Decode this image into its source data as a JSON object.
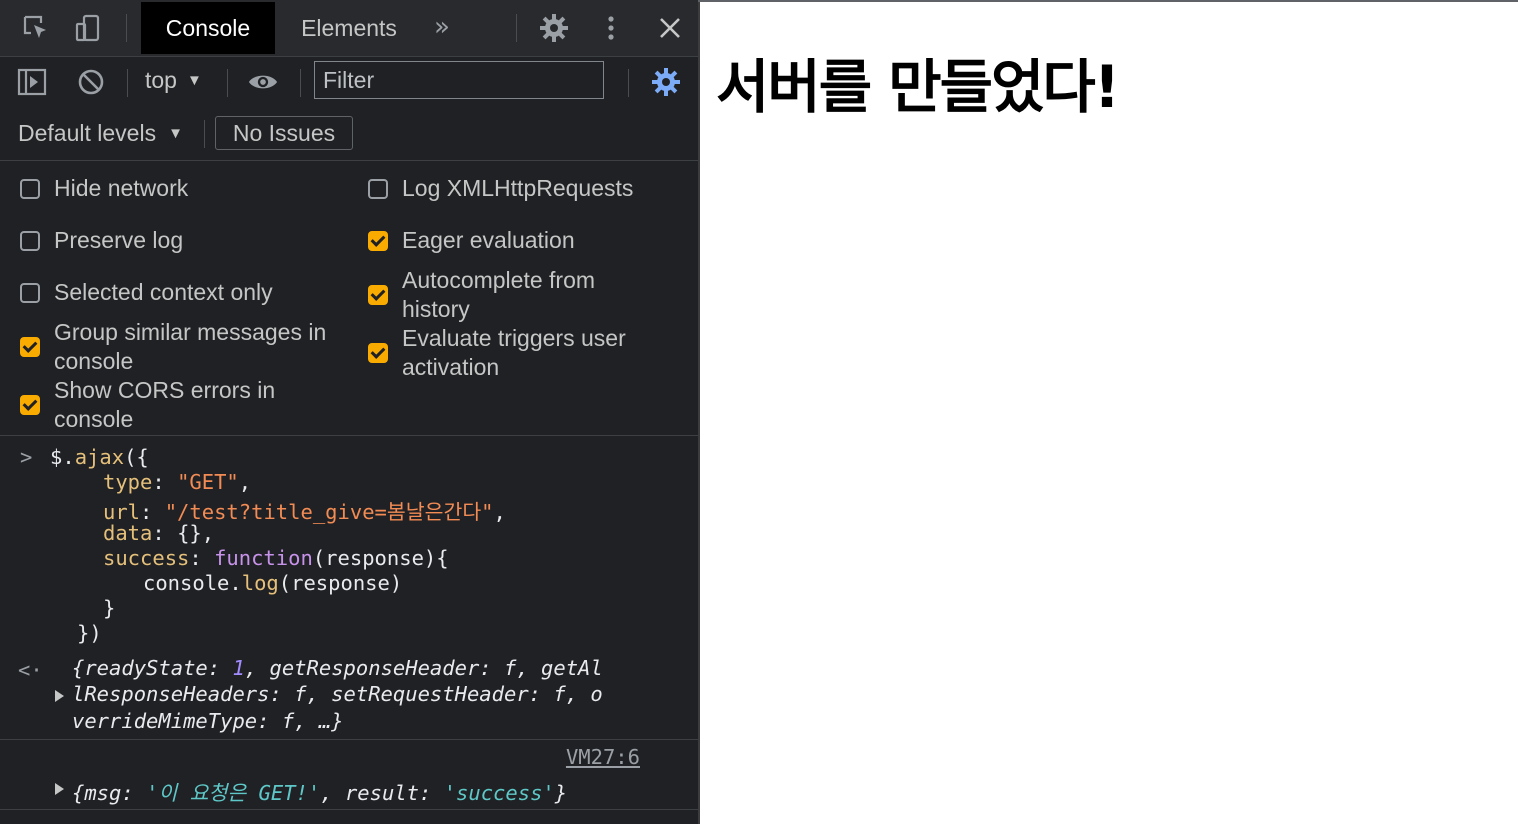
{
  "devtools": {
    "tabs": [
      {
        "label": "Console",
        "active": true
      },
      {
        "label": "Elements",
        "active": false
      }
    ],
    "more_tabs": "»",
    "toolbar": {
      "context": "top",
      "filter_placeholder": "Filter",
      "default_levels": "Default levels",
      "issues_label": "No Issues"
    },
    "settings": {
      "left": [
        {
          "label": "Hide network",
          "checked": false
        },
        {
          "label": "Preserve log",
          "checked": false
        },
        {
          "label": "Selected context only",
          "checked": false
        },
        {
          "label": "Group similar messages in console",
          "checked": true
        },
        {
          "label": "Show CORS errors in console",
          "checked": true
        }
      ],
      "right": [
        {
          "label": "Log XMLHttpRequests",
          "checked": false
        },
        {
          "label": "Eager evaluation",
          "checked": true
        },
        {
          "label": "Autocomplete from history",
          "checked": true
        },
        {
          "label": "Evaluate triggers user activation",
          "checked": true
        }
      ]
    },
    "console": {
      "input": {
        "line1_obj": "$.",
        "line1_fn": "ajax",
        "line1_rest": "({",
        "type_key": "type",
        "type_val": "\"GET\"",
        "url_key": "url",
        "url_val": "\"/test?title_give=봄날은간다\"",
        "data_key": "data",
        "data_val": "{}",
        "success_key": "success",
        "success_kw": "function",
        "success_rest": "(response){",
        "log_obj": "console.",
        "log_fn": "log",
        "log_rest": "(response)",
        "close_inner": "}",
        "close_outer": "})"
      },
      "return_value": {
        "readyState_key": "readyState",
        "readyState_val": "1",
        "line1_rest": "getResponseHeader: f, getAl",
        "line2": "lResponseHeaders: f, setRequestHeader: f, o",
        "line3": "verrideMimeType: f, …}"
      },
      "log_source": "VM27:6",
      "log_output": {
        "msg_key": "msg",
        "msg_val": "'이 요청은 GET!'",
        "result_key": "result",
        "result_val": "'success'"
      }
    }
  },
  "page": {
    "heading": "서버를 만들었다!"
  }
}
